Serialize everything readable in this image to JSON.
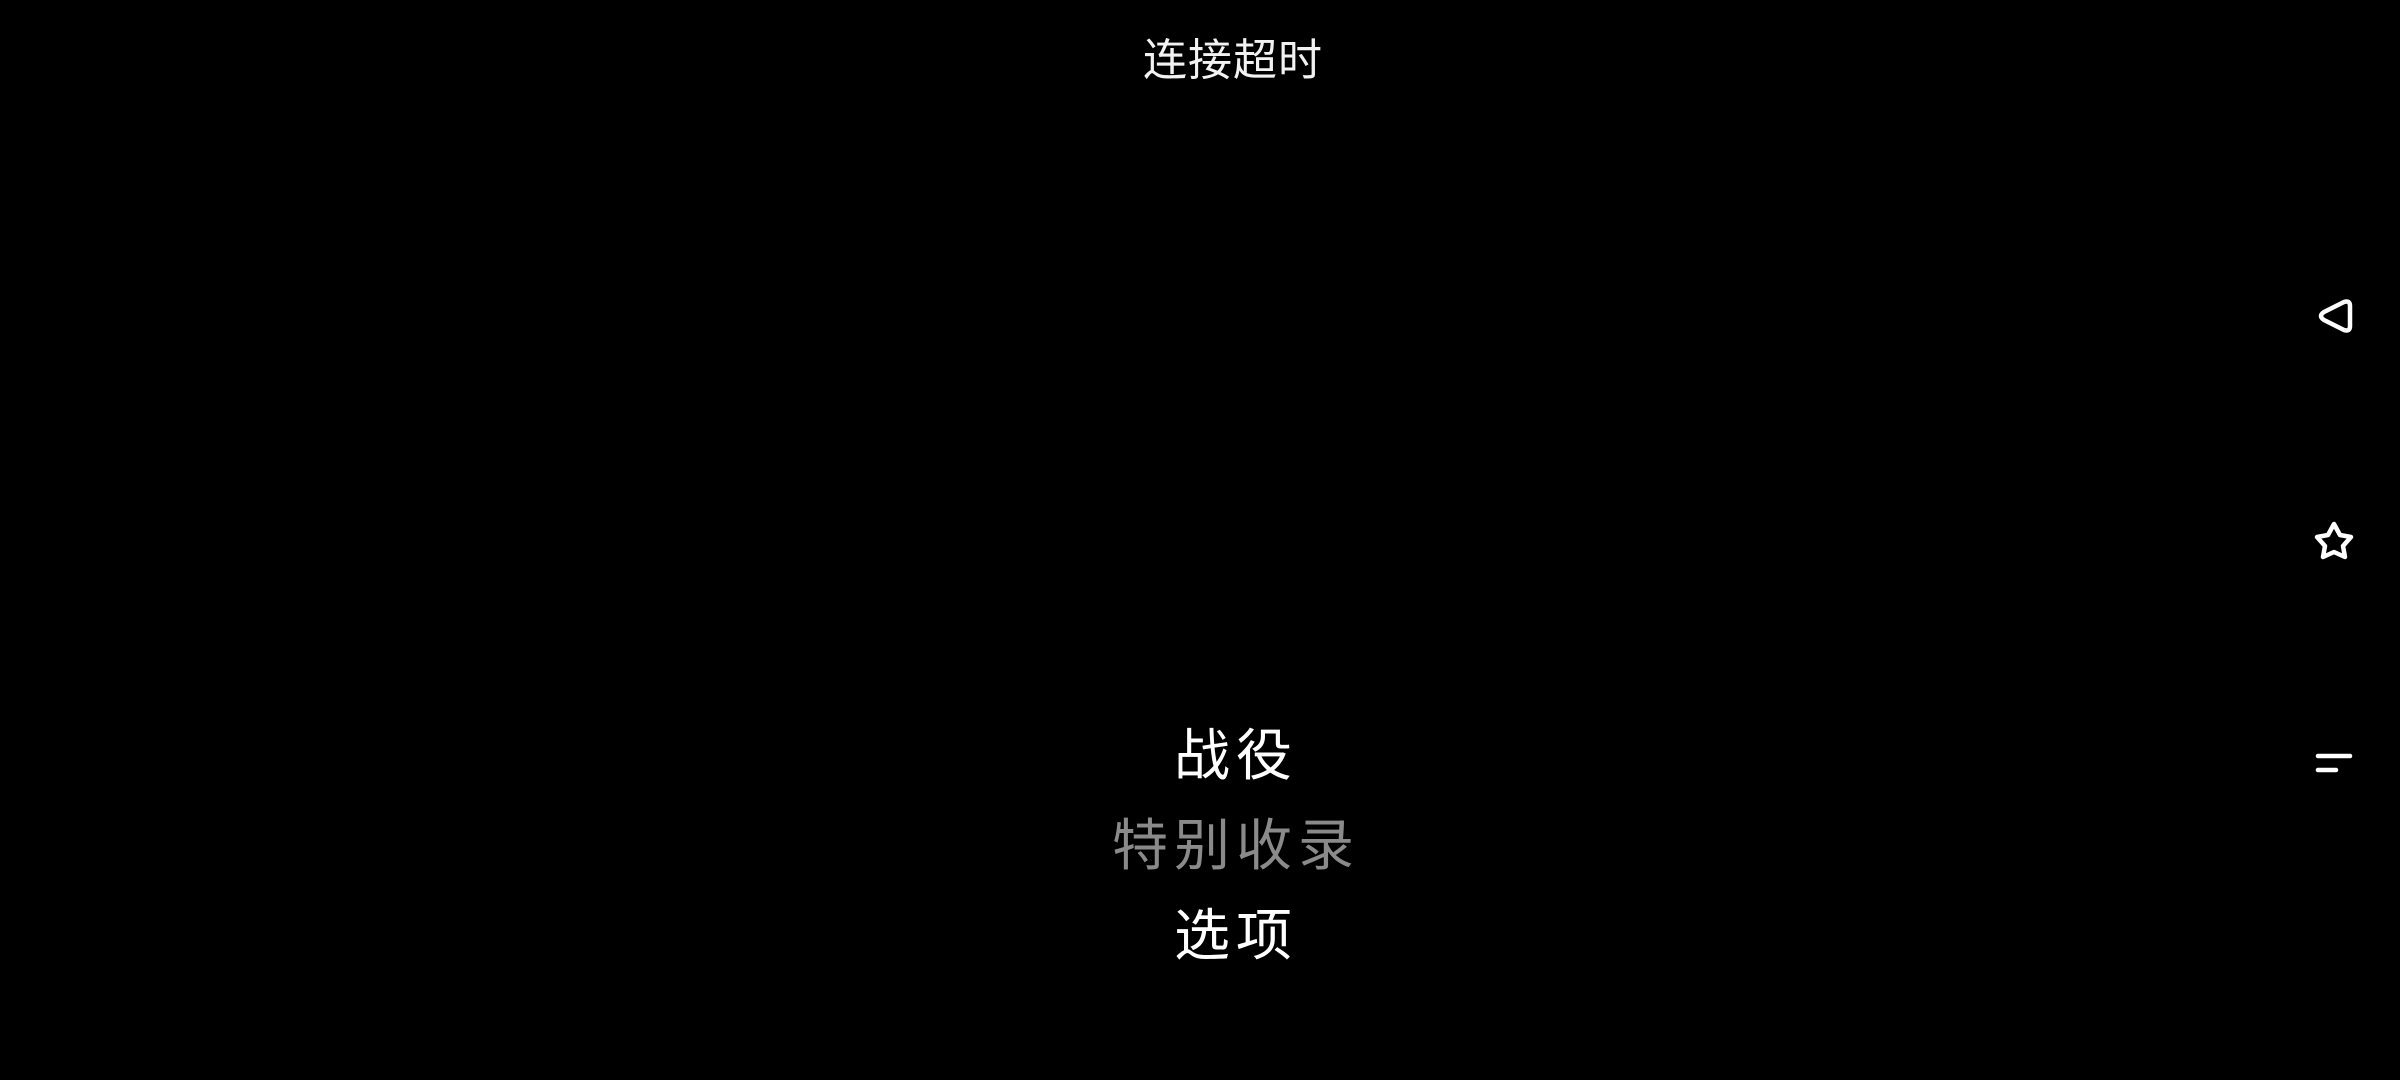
{
  "status": {
    "message": "连接超时"
  },
  "menu": {
    "items": [
      {
        "label": "战役",
        "enabled": true
      },
      {
        "label": "特别收录",
        "enabled": false
      },
      {
        "label": "选项",
        "enabled": true
      }
    ]
  },
  "nav_bar": {
    "buttons": [
      {
        "icon": "back-icon"
      },
      {
        "icon": "home-icon"
      },
      {
        "icon": "recents-icon"
      }
    ]
  },
  "colors": {
    "background": "#000000",
    "text": "#ffffff",
    "disabled_text": "#8a8a8a"
  }
}
